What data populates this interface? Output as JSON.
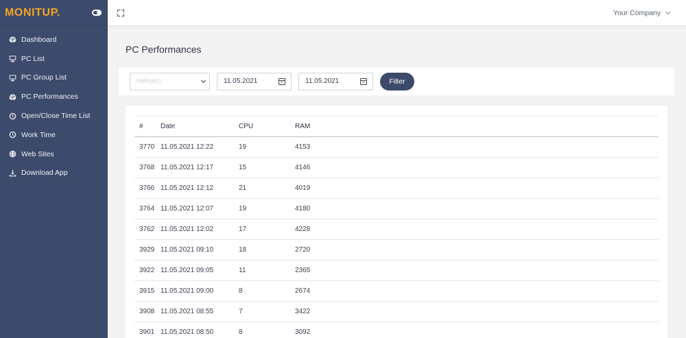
{
  "brand": {
    "name": "MONITUP."
  },
  "colors": {
    "sidebar": "#3c4a6b",
    "accent": "#f5a623",
    "button": "#3c4a6b"
  },
  "sidebar": {
    "items": [
      {
        "label": "Dashboard",
        "icon": "dashboard-gauge-icon"
      },
      {
        "label": "PC List",
        "icon": "monitor-icon"
      },
      {
        "label": "PC Group List",
        "icon": "monitor-icon"
      },
      {
        "label": "PC Performances",
        "icon": "dashboard-gauge-icon"
      },
      {
        "label": "Open/Close Time List",
        "icon": "clock-icon"
      },
      {
        "label": "Work Time",
        "icon": "clock-icon"
      },
      {
        "label": "Web Sites",
        "icon": "globe-icon"
      },
      {
        "label": "Download App",
        "icon": "download-icon"
      }
    ]
  },
  "topbar": {
    "company": "Your Company"
  },
  "page": {
    "title": "PC Performances"
  },
  "filter": {
    "pc_select_value": "PAPUKO",
    "start_date": "11.05.2021",
    "end_date": "11.05.2021",
    "button_label": "Filter"
  },
  "table": {
    "headers": [
      "#",
      "Date",
      "CPU",
      "RAM"
    ],
    "rows": [
      [
        "3770",
        "11.05.2021 12:22",
        "19",
        "4153"
      ],
      [
        "3768",
        "11.05.2021 12:17",
        "15",
        "4146"
      ],
      [
        "3766",
        "11.05.2021 12:12",
        "21",
        "4019"
      ],
      [
        "3764",
        "11.05.2021 12:07",
        "19",
        "4180"
      ],
      [
        "3762",
        "11.05.2021 12:02",
        "17",
        "4228"
      ],
      [
        "3929",
        "11.05.2021 09:10",
        "18",
        "2720"
      ],
      [
        "3922",
        "11.05.2021 09:05",
        "11",
        "2365"
      ],
      [
        "3915",
        "11.05.2021 09:00",
        "8",
        "2674"
      ],
      [
        "3908",
        "11.05.2021 08:55",
        "7",
        "3422"
      ],
      [
        "3901",
        "11.05.2021 08:50",
        "8",
        "3092"
      ]
    ]
  }
}
